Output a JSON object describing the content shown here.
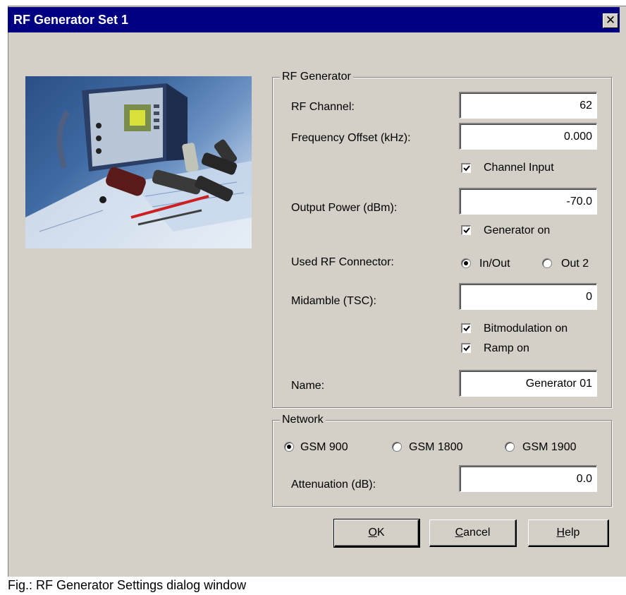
{
  "window": {
    "title": "RF Generator Set 1",
    "close_symbol": "✕"
  },
  "rf_generator": {
    "group_label": "RF Generator",
    "rf_channel_label": "RF Channel:",
    "rf_channel_value": "62",
    "freq_offset_label": "Frequency Offset (kHz):",
    "freq_offset_value": "0.000",
    "channel_input_label": "Channel Input",
    "channel_input_checked": true,
    "output_power_label": "Output Power (dBm):",
    "output_power_value": "-70.0",
    "generator_on_label": "Generator on",
    "generator_on_checked": true,
    "connector_label": "Used RF Connector:",
    "connector_options": [
      "In/Out",
      "Out 2"
    ],
    "connector_selected": "In/Out",
    "midamble_label": "Midamble (TSC):",
    "midamble_value": "0",
    "bitmodulation_label": "Bitmodulation on",
    "bitmodulation_checked": true,
    "ramp_label": "Ramp on",
    "ramp_checked": true,
    "name_label": "Name:",
    "name_value": "Generator 01"
  },
  "network": {
    "group_label": "Network",
    "options": [
      "GSM 900",
      "GSM 1800",
      "GSM 1900"
    ],
    "selected": "GSM 900",
    "attenuation_label": "Attenuation (dB):",
    "attenuation_value": "0.0"
  },
  "buttons": {
    "ok": {
      "mnemonic": "O",
      "rest": "K"
    },
    "cancel": {
      "mnemonic": "C",
      "rest": "ancel"
    },
    "help": {
      "mnemonic": "H",
      "rest": "elp"
    }
  },
  "caption": "Fig.: RF Generator Settings dialog window",
  "colors": {
    "titlebar": "#000080",
    "dialog_bg": "#d4d0c8"
  }
}
